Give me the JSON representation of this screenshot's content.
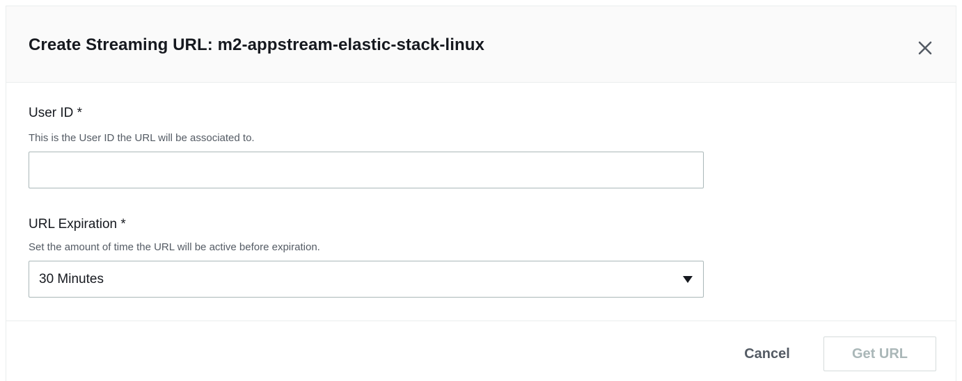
{
  "modal": {
    "title": "Create Streaming URL: m2-appstream-elastic-stack-linux",
    "close_icon": "close-icon"
  },
  "user_id": {
    "label": "User ID *",
    "description": "This is the User ID the URL will be associated to.",
    "value": "",
    "placeholder": ""
  },
  "url_expiration": {
    "label": "URL Expiration *",
    "description": "Set the amount of time the URL will be active before expiration.",
    "selected": "30 Minutes",
    "caret_icon": "caret-down-icon"
  },
  "footer": {
    "cancel_label": "Cancel",
    "get_url_label": "Get URL",
    "get_url_disabled": true
  },
  "colors": {
    "header_bg": "#fafafa",
    "text": "#16191f",
    "muted": "#545b64",
    "border": "#aab7b8",
    "disabled": "#aab7b8"
  }
}
